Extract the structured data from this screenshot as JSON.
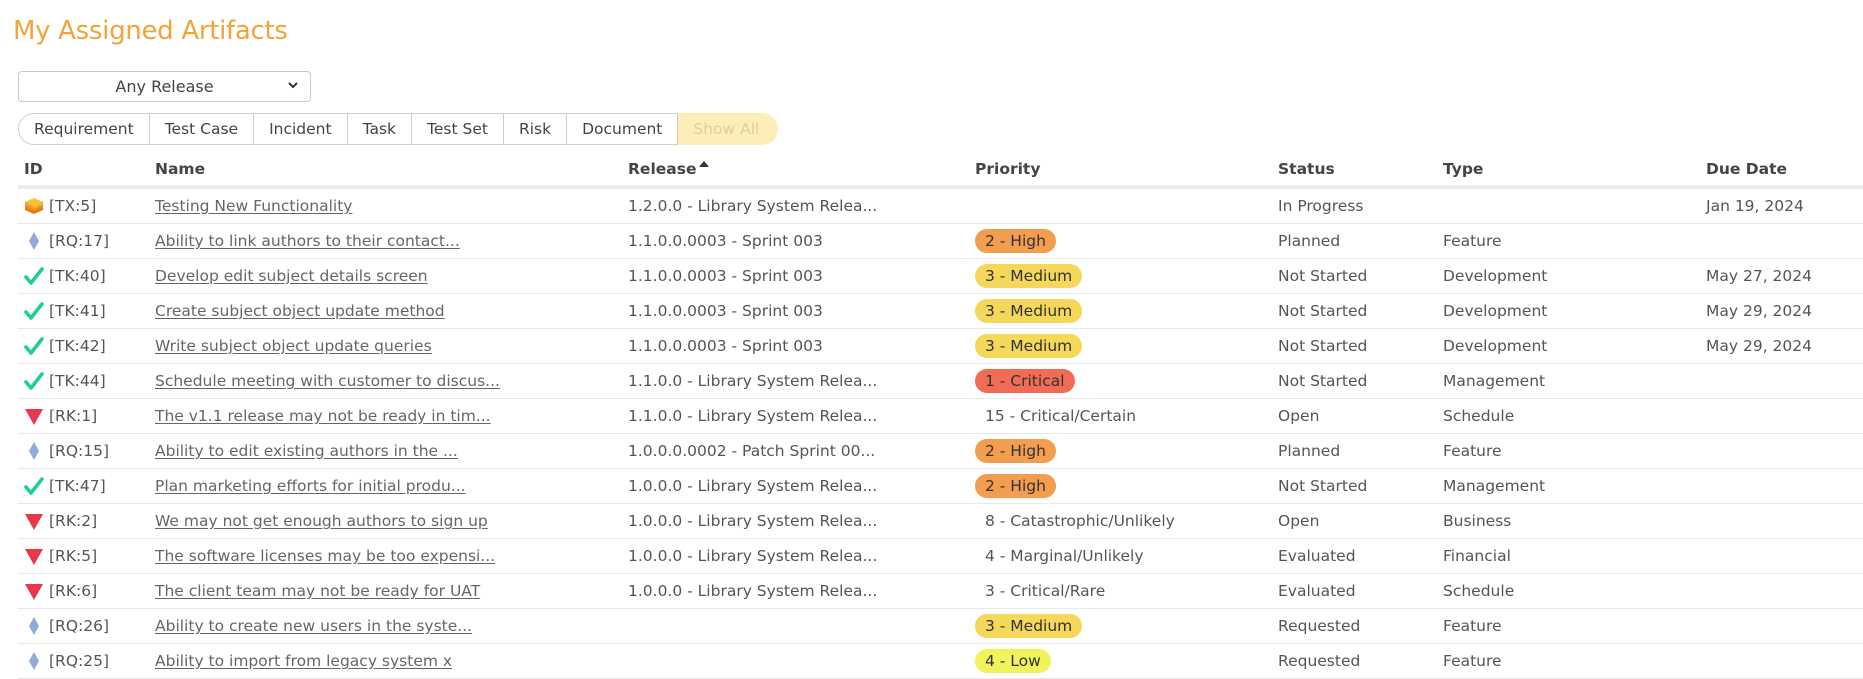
{
  "page": {
    "title": "My Assigned Artifacts"
  },
  "release_filter": {
    "selected": "Any Release"
  },
  "artifact_filters": [
    {
      "label": "Requirement",
      "active": false
    },
    {
      "label": "Test Case",
      "active": false
    },
    {
      "label": "Incident",
      "active": false
    },
    {
      "label": "Task",
      "active": false
    },
    {
      "label": "Test Set",
      "active": false
    },
    {
      "label": "Risk",
      "active": false
    },
    {
      "label": "Document",
      "active": false
    },
    {
      "label": "Show All",
      "active": true
    }
  ],
  "table": {
    "columns": [
      "ID",
      "Name",
      "Release",
      "Priority",
      "Status",
      "Type",
      "Due Date"
    ],
    "sorted_column": "Release",
    "sort_direction": "ascending",
    "rows": [
      {
        "icon": "test-set-icon",
        "id": "[TX:5]",
        "name": "Testing New Functionality",
        "release": "1.2.0.0 - Library System Relea...",
        "priority": "",
        "priority_style": "none",
        "status": "In Progress",
        "type": "",
        "due": "Jan 19, 2024"
      },
      {
        "icon": "requirement-icon",
        "id": "[RQ:17]",
        "name": "Ability to link authors to their contact...",
        "release": "1.1.0.0.0003 - Sprint 003",
        "priority": "2 - High",
        "priority_style": "high",
        "status": "Planned",
        "type": "Feature",
        "due": ""
      },
      {
        "icon": "task-icon",
        "id": "[TK:40]",
        "name": "Develop edit subject details screen",
        "release": "1.1.0.0.0003 - Sprint 003",
        "priority": "3 - Medium",
        "priority_style": "medium",
        "status": "Not Started",
        "type": "Development",
        "due": "May 27, 2024"
      },
      {
        "icon": "task-icon",
        "id": "[TK:41]",
        "name": "Create subject object update method",
        "release": "1.1.0.0.0003 - Sprint 003",
        "priority": "3 - Medium",
        "priority_style": "medium",
        "status": "Not Started",
        "type": "Development",
        "due": "May 29, 2024"
      },
      {
        "icon": "task-icon",
        "id": "[TK:42]",
        "name": "Write subject object update queries",
        "release": "1.1.0.0.0003 - Sprint 003",
        "priority": "3 - Medium",
        "priority_style": "medium",
        "status": "Not Started",
        "type": "Development",
        "due": "May 29, 2024"
      },
      {
        "icon": "task-icon",
        "id": "[TK:44]",
        "name": "Schedule meeting with customer to discus...",
        "release": "1.1.0.0 - Library System Relea...",
        "priority": "1 - Critical",
        "priority_style": "critical",
        "status": "Not Started",
        "type": "Management",
        "due": ""
      },
      {
        "icon": "risk-icon",
        "id": "[RK:1]",
        "name": "The v1.1 release may not be ready in tim...",
        "release": "1.1.0.0 - Library System Relea...",
        "priority": "15 - Critical/Certain",
        "priority_style": "plain",
        "status": "Open",
        "type": "Schedule",
        "due": ""
      },
      {
        "icon": "requirement-icon",
        "id": "[RQ:15]",
        "name": "Ability to edit existing authors in the ...",
        "release": "1.0.0.0.0002 - Patch Sprint 00...",
        "priority": "2 - High",
        "priority_style": "high",
        "status": "Planned",
        "type": "Feature",
        "due": ""
      },
      {
        "icon": "task-icon",
        "id": "[TK:47]",
        "name": "Plan marketing efforts for initial produ...",
        "release": "1.0.0.0 - Library System Relea...",
        "priority": "2 - High",
        "priority_style": "high",
        "status": "Not Started",
        "type": "Management",
        "due": ""
      },
      {
        "icon": "risk-icon",
        "id": "[RK:2]",
        "name": "We may not get enough authors to sign up",
        "release": "1.0.0.0 - Library System Relea...",
        "priority": "8 - Catastrophic/Unlikely",
        "priority_style": "plain",
        "status": "Open",
        "type": "Business",
        "due": ""
      },
      {
        "icon": "risk-icon",
        "id": "[RK:5]",
        "name": "The software licenses may be too expensi...",
        "release": "1.0.0.0 - Library System Relea...",
        "priority": "4 - Marginal/Unlikely",
        "priority_style": "plain",
        "status": "Evaluated",
        "type": "Financial",
        "due": ""
      },
      {
        "icon": "risk-icon",
        "id": "[RK:6]",
        "name": "The client team may not be ready for UAT",
        "release": "1.0.0.0 - Library System Relea...",
        "priority": "3 - Critical/Rare",
        "priority_style": "plain",
        "status": "Evaluated",
        "type": "Schedule",
        "due": ""
      },
      {
        "icon": "requirement-icon",
        "id": "[RQ:26]",
        "name": "Ability to create new users in the syste...",
        "release": "",
        "priority": "3 - Medium",
        "priority_style": "medium",
        "status": "Requested",
        "type": "Feature",
        "due": ""
      },
      {
        "icon": "requirement-icon",
        "id": "[RQ:25]",
        "name": "Ability to import from legacy system x",
        "release": "",
        "priority": "4 - Low",
        "priority_style": "low",
        "status": "Requested",
        "type": "Feature",
        "due": ""
      }
    ]
  },
  "colors": {
    "title": "#f2a43a",
    "priority_critical": "#f26c55",
    "priority_high": "#f29d50",
    "priority_medium": "#f5d85a",
    "priority_low": "#f2f25a",
    "overdue": "#f03030",
    "show_all_bg": "#fdeeb9"
  }
}
